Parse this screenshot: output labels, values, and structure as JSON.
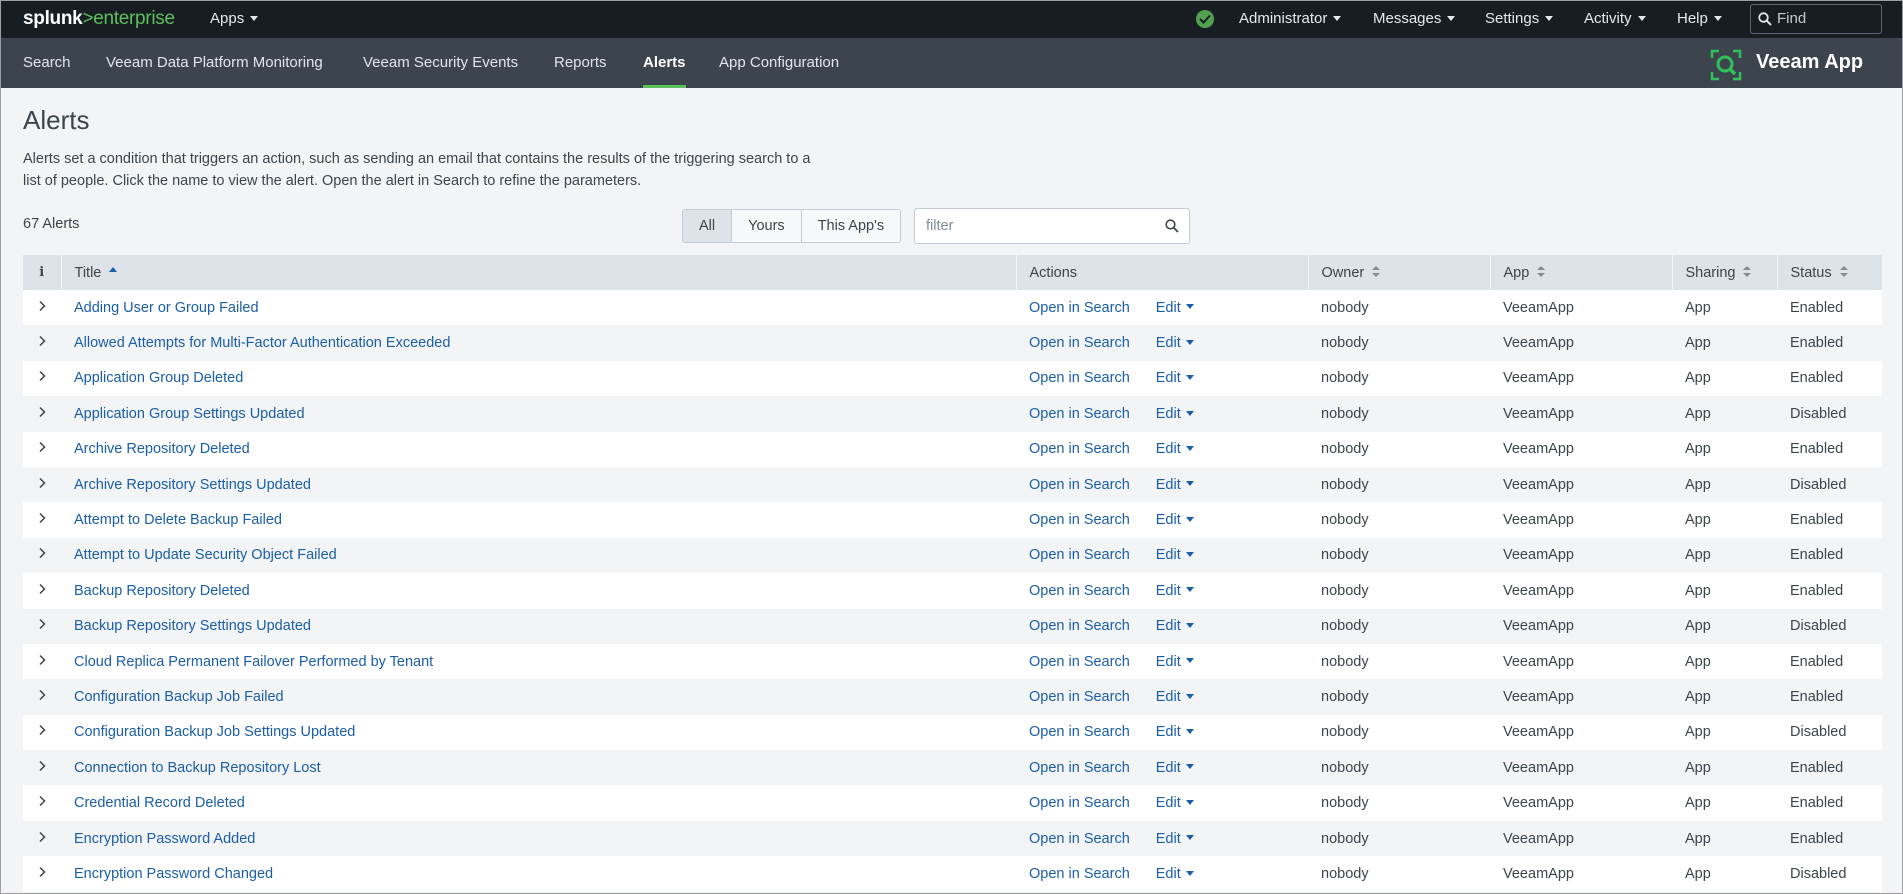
{
  "brand": {
    "splunk": "splunk",
    "separator": ">",
    "product": "enterprise"
  },
  "topnav": {
    "apps": "Apps",
    "administrator": "Administrator",
    "messages": "Messages",
    "settings": "Settings",
    "activity": "Activity",
    "help": "Help",
    "find_placeholder": "Find"
  },
  "appnav": {
    "items": [
      "Search",
      "Veeam Data Platform Monitoring",
      "Veeam Security Events",
      "Reports",
      "Alerts",
      "App Configuration"
    ],
    "active": "Alerts",
    "app_label": "Veeam App"
  },
  "page": {
    "title": "Alerts",
    "description": "Alerts set a condition that triggers an action, such as sending an email that contains the results of the triggering search to a list of people. Click the name to view the alert. Open the alert in Search to refine the parameters.",
    "count": "67 Alerts"
  },
  "filters": {
    "all": "All",
    "yours": "Yours",
    "this_app": "This App's",
    "selected": "All",
    "filter_placeholder": "filter"
  },
  "table": {
    "columns": {
      "info": "i",
      "title": "Title",
      "actions": "Actions",
      "owner": "Owner",
      "app": "App",
      "sharing": "Sharing",
      "status": "Status"
    },
    "open_in_search": "Open in Search",
    "edit": "Edit",
    "rows": [
      {
        "title": "Adding User or Group Failed",
        "owner": "nobody",
        "app": "VeeamApp",
        "sharing": "App",
        "status": "Enabled"
      },
      {
        "title": "Allowed Attempts for Multi-Factor Authentication Exceeded",
        "owner": "nobody",
        "app": "VeeamApp",
        "sharing": "App",
        "status": "Enabled"
      },
      {
        "title": "Application Group Deleted",
        "owner": "nobody",
        "app": "VeeamApp",
        "sharing": "App",
        "status": "Enabled"
      },
      {
        "title": "Application Group Settings Updated",
        "owner": "nobody",
        "app": "VeeamApp",
        "sharing": "App",
        "status": "Disabled"
      },
      {
        "title": "Archive Repository Deleted",
        "owner": "nobody",
        "app": "VeeamApp",
        "sharing": "App",
        "status": "Enabled"
      },
      {
        "title": "Archive Repository Settings Updated",
        "owner": "nobody",
        "app": "VeeamApp",
        "sharing": "App",
        "status": "Disabled"
      },
      {
        "title": "Attempt to Delete Backup Failed",
        "owner": "nobody",
        "app": "VeeamApp",
        "sharing": "App",
        "status": "Enabled"
      },
      {
        "title": "Attempt to Update Security Object Failed",
        "owner": "nobody",
        "app": "VeeamApp",
        "sharing": "App",
        "status": "Enabled"
      },
      {
        "title": "Backup Repository Deleted",
        "owner": "nobody",
        "app": "VeeamApp",
        "sharing": "App",
        "status": "Enabled"
      },
      {
        "title": "Backup Repository Settings Updated",
        "owner": "nobody",
        "app": "VeeamApp",
        "sharing": "App",
        "status": "Disabled"
      },
      {
        "title": "Cloud Replica Permanent Failover Performed by Tenant",
        "owner": "nobody",
        "app": "VeeamApp",
        "sharing": "App",
        "status": "Enabled"
      },
      {
        "title": "Configuration Backup Job Failed",
        "owner": "nobody",
        "app": "VeeamApp",
        "sharing": "App",
        "status": "Enabled"
      },
      {
        "title": "Configuration Backup Job Settings Updated",
        "owner": "nobody",
        "app": "VeeamApp",
        "sharing": "App",
        "status": "Disabled"
      },
      {
        "title": "Connection to Backup Repository Lost",
        "owner": "nobody",
        "app": "VeeamApp",
        "sharing": "App",
        "status": "Enabled"
      },
      {
        "title": "Credential Record Deleted",
        "owner": "nobody",
        "app": "VeeamApp",
        "sharing": "App",
        "status": "Enabled"
      },
      {
        "title": "Encryption Password Added",
        "owner": "nobody",
        "app": "VeeamApp",
        "sharing": "App",
        "status": "Enabled"
      },
      {
        "title": "Encryption Password Changed",
        "owner": "nobody",
        "app": "VeeamApp",
        "sharing": "App",
        "status": "Disabled"
      }
    ]
  },
  "colors": {
    "topbar": "#171d21",
    "appbar": "#3c444d",
    "accent_green": "#5cc05c",
    "link": "#1a5ea8"
  },
  "icons": {
    "status": "check-circle-icon",
    "find": "search-icon",
    "veeam": "veeam-logo-icon",
    "expand": "chevron-right-icon"
  }
}
